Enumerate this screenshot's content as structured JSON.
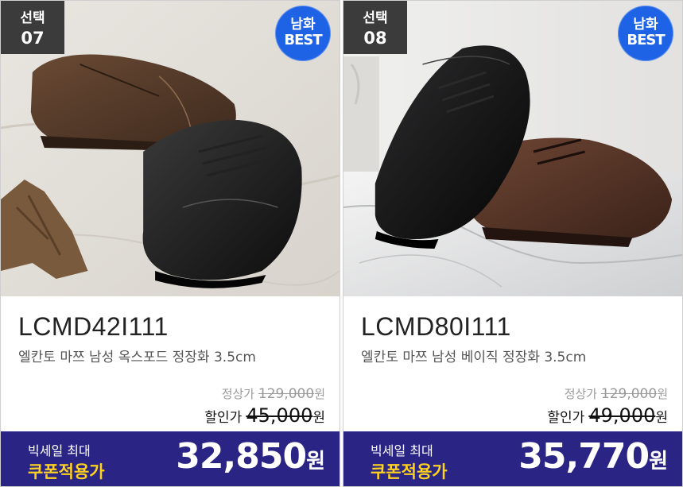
{
  "products": [
    {
      "select_label": "선택",
      "select_number": "07",
      "badge_line1": "남화",
      "badge_line2": "BEST",
      "model": "LCMD42I111",
      "description": "엘칸토 마쯔 남성 옥스포드 정장화 3.5cm",
      "list_price_label": "정상가",
      "list_price": "129,000",
      "list_price_unit": "원",
      "sale_label": "할인가",
      "sale_price": "45,000",
      "sale_unit": "원",
      "coupon_max": "빅세일 최대",
      "coupon_label": "쿠폰적용가",
      "coupon_price": "32,850",
      "coupon_unit": "원"
    },
    {
      "select_label": "선택",
      "select_number": "08",
      "badge_line1": "남화",
      "badge_line2": "BEST",
      "model": "LCMD80I111",
      "description": "엘칸토 마쯔 남성 베이직 정장화 3.5cm",
      "list_price_label": "정상가",
      "list_price": "129,000",
      "list_price_unit": "원",
      "sale_label": "할인가",
      "sale_price": "49,000",
      "sale_unit": "원",
      "coupon_max": "빅세일 최대",
      "coupon_label": "쿠폰적용가",
      "coupon_price": "35,770",
      "coupon_unit": "원"
    }
  ],
  "colors": {
    "badge_dark": "#3b3b3b",
    "best_blue": "#1e63e6",
    "coupon_bg": "#2a2584",
    "coupon_text": "#ffd21f"
  }
}
